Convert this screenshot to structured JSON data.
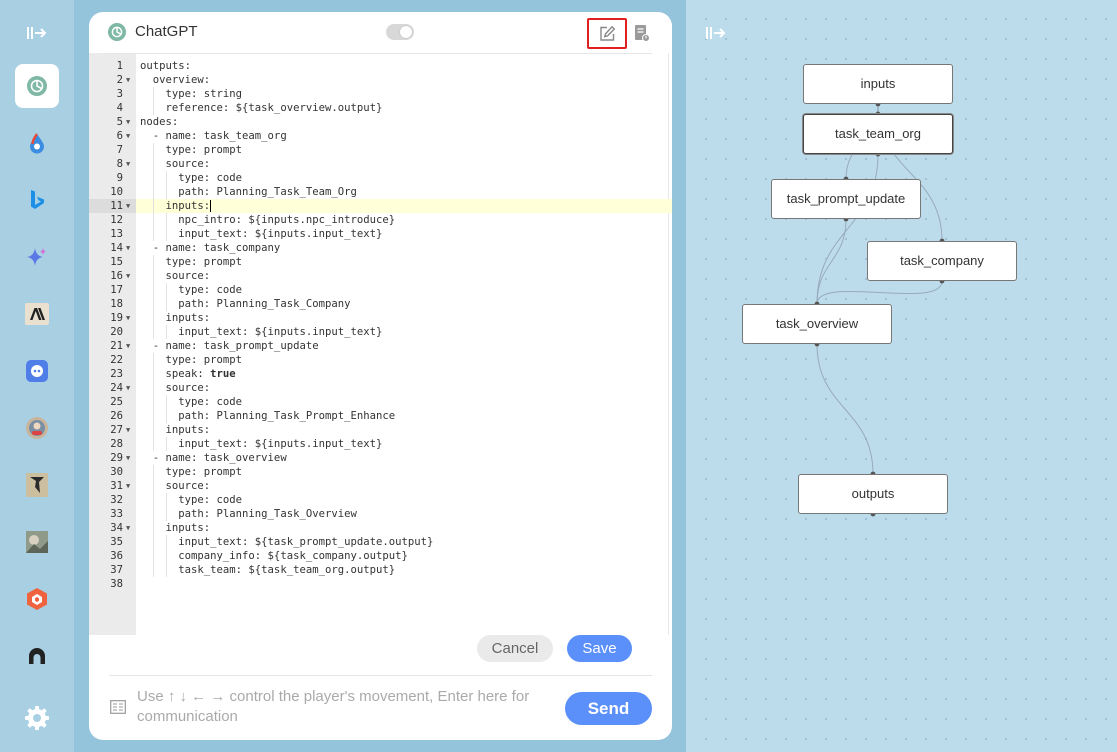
{
  "app": {
    "panel_title": "ChatGPT"
  },
  "rail": {
    "items": [
      {
        "name": "chatgpt",
        "icon": "chatgpt-icon",
        "active": true
      },
      {
        "name": "droplet",
        "icon": "droplet-icon"
      },
      {
        "name": "bing",
        "icon": "bing-icon"
      },
      {
        "name": "gemini",
        "icon": "sparkle-icon"
      },
      {
        "name": "anthropic",
        "icon": "anthropic-icon"
      },
      {
        "name": "discord",
        "icon": "discord-bot-icon"
      },
      {
        "name": "avatar-bot",
        "icon": "avatar-icon"
      },
      {
        "name": "sketch-bot",
        "icon": "sketch-icon"
      },
      {
        "name": "photo-bot",
        "icon": "photo-icon"
      },
      {
        "name": "cube-bot",
        "icon": "cube-icon"
      },
      {
        "name": "headset-bot",
        "icon": "headset-icon"
      }
    ],
    "settings_icon": "gear-icon"
  },
  "editor": {
    "active_line": 11,
    "lines": [
      "outputs:",
      "  overview:",
      "    type: string",
      "    reference: ${task_overview.output}",
      "nodes:",
      "  - name: task_team_org",
      "    type: prompt",
      "    source:",
      "      type: code",
      "      path: Planning_Task_Team_Org",
      "    inputs:",
      "      npc_intro: ${inputs.npc_introduce}",
      "      input_text: ${inputs.input_text}",
      "  - name: task_company",
      "    type: prompt",
      "    source:",
      "      type: code",
      "      path: Planning_Task_Company",
      "    inputs:",
      "      input_text: ${inputs.input_text}",
      "  - name: task_prompt_update",
      "    type: prompt",
      "    speak: true",
      "    source:",
      "      type: code",
      "      path: Planning_Task_Prompt_Enhance",
      "    inputs:",
      "      input_text: ${inputs.input_text}",
      "  - name: task_overview",
      "    type: prompt",
      "    source:",
      "      type: code",
      "      path: Planning_Task_Overview",
      "    inputs:",
      "      input_text: ${task_prompt_update.output}",
      "      company_info: ${task_company.output}",
      "      task_team: ${task_team_org.output}",
      ""
    ],
    "fold_lines": [
      2,
      5,
      6,
      8,
      11,
      14,
      16,
      19,
      21,
      24,
      27,
      29,
      31,
      34
    ]
  },
  "actions": {
    "cancel_label": "Cancel",
    "save_label": "Save"
  },
  "chat_input": {
    "placeholder": "Use ↑ ↓ ← → control the player's movement, Enter here for communication",
    "value": "",
    "send_label": "Send"
  },
  "flow": {
    "nodes": [
      {
        "id": "inputs",
        "label": "inputs"
      },
      {
        "id": "task_team_org",
        "label": "task_team_org",
        "selected": true
      },
      {
        "id": "task_prompt_update",
        "label": "task_prompt_update"
      },
      {
        "id": "task_company",
        "label": "task_company"
      },
      {
        "id": "task_overview",
        "label": "task_overview"
      },
      {
        "id": "outputs",
        "label": "outputs"
      }
    ],
    "edges": [
      [
        "inputs",
        "task_team_org"
      ],
      [
        "inputs",
        "task_prompt_update"
      ],
      [
        "inputs",
        "task_company"
      ],
      [
        "task_team_org",
        "task_overview"
      ],
      [
        "task_prompt_update",
        "task_overview"
      ],
      [
        "task_company",
        "task_overview"
      ],
      [
        "task_overview",
        "outputs"
      ]
    ]
  },
  "colors": {
    "accent": "#5b8ff9",
    "highlight": "#e02020",
    "active_line": "#ffffd8"
  }
}
